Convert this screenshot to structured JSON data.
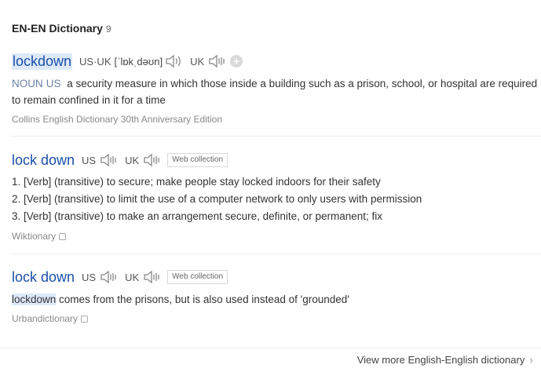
{
  "section": {
    "title": "EN-EN Dictionary",
    "count": "9"
  },
  "entries": [
    {
      "word": "lockdown",
      "region_us_uk": "US·UK",
      "ipa": "[ˈlɒkˌdəʊn]",
      "uk_label": "UK",
      "pos": "NOUN",
      "pos_region": "US",
      "definition": "a security measure in which those inside a building such as a prison, school, or hospital are required to remain confined in it for a time",
      "source": "Collins English Dictionary 30th Anniversary Edition"
    },
    {
      "word": "lock down",
      "us_label": "US",
      "uk_label": "UK",
      "tag": "Web collection",
      "senses": [
        "1. [Verb] (transitive) to secure; make people stay locked indoors for their safety",
        "2. [Verb] (transitive) to limit the use of a computer network to only users with permission",
        "3. [Verb] (transitive) to make an arrangement secure, definite, or permanent; fix"
      ],
      "source": "Wiktionary"
    },
    {
      "word": "lock down",
      "us_label": "US",
      "uk_label": "UK",
      "tag": "Web collection",
      "highlight": "lockdown",
      "rest": " comes from the prisons, but is also used instead of 'grounded'",
      "source": "Urbandictionary"
    }
  ],
  "more_link": "View more English-English dictionary",
  "icons": {
    "speaker": "speaker-icon",
    "plus": "plus-icon",
    "external": "external-link-icon",
    "chevron": "chevron-right-icon"
  },
  "colors": {
    "word": "#1a4fa8",
    "highlight": "#dde9f9",
    "pos": "#6b7fa8"
  }
}
